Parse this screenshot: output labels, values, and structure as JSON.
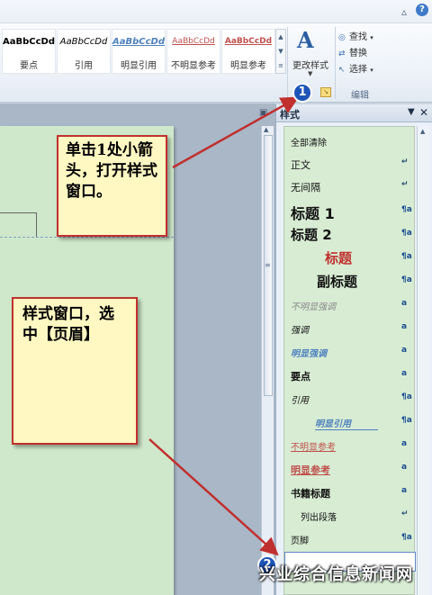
{
  "ribbon": {
    "window_caret": "▵",
    "help": "?",
    "gallery": [
      {
        "sample": "AaBbCcDd",
        "label": "要点",
        "color": "#111111"
      },
      {
        "sample": "AaBbCcDd",
        "label": "引用",
        "color": "#222222"
      },
      {
        "sample": "AaBbCcDd",
        "label": "明显引用",
        "color": "#4f81bd"
      },
      {
        "sample": "AaBbCcDd",
        "label": "不明显参考",
        "color": "#c0504d"
      },
      {
        "sample": "AaBbCcDd",
        "label": "明显参考",
        "color": "#c0504d"
      }
    ],
    "gallery_scroll": "▲ ▼ ≡",
    "change_style": {
      "icon": "A",
      "label": "更改样式",
      "caret": "▼"
    },
    "editing": {
      "find": "查找",
      "replace": "替换",
      "select": "选择",
      "group_label": "编辑"
    },
    "launcher": "↘"
  },
  "styles_pane": {
    "title": "样式",
    "menu": "▼",
    "close": "✕",
    "items": [
      {
        "name": "全部清除",
        "mark": ""
      },
      {
        "name": "正文",
        "mark": "↵"
      },
      {
        "name": "无间隔",
        "mark": "↵"
      },
      {
        "name": "标题 1",
        "mark": "¶a"
      },
      {
        "name": "标题 2",
        "mark": "¶a"
      },
      {
        "name": "标题",
        "mark": "¶a"
      },
      {
        "name": "副标题",
        "mark": "¶a"
      },
      {
        "name": "不明显强调",
        "mark": "a"
      },
      {
        "name": "强调",
        "mark": "a"
      },
      {
        "name": "明显强调",
        "mark": "a"
      },
      {
        "name": "要点",
        "mark": "a"
      },
      {
        "name": "引用",
        "mark": "¶a"
      },
      {
        "name": "明显引用",
        "mark": "¶a"
      },
      {
        "name": "不明显参考",
        "mark": "a"
      },
      {
        "name": "明显参考",
        "mark": "a"
      },
      {
        "name": "书籍标题",
        "mark": "a"
      },
      {
        "name": "列出段落",
        "mark": "↵"
      },
      {
        "name": "页脚",
        "mark": "¶a"
      }
    ]
  },
  "callouts": {
    "c1": "单击1处小箭头，打开样式窗口。",
    "c2": "样式窗口，选中【页眉】"
  },
  "badges": {
    "b1": "1",
    "b2": "2"
  },
  "watermark": "兴业综合信息新闻网",
  "colors": {
    "accent": "#c0302e",
    "badge": "#1d54b8",
    "page": "#cfe8cb",
    "note": "#fff8c2"
  }
}
